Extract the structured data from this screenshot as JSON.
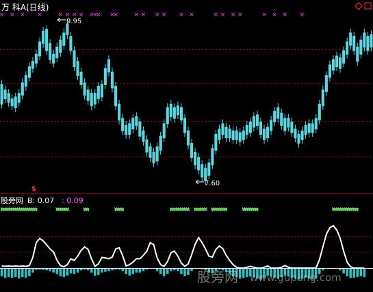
{
  "header": {
    "title": "万  科A(日线)",
    "icons": [
      "diamond-icon",
      "square-icon"
    ]
  },
  "sub_panel": {
    "label": "股旁网",
    "b_label": "B: 0.07",
    "c_label": ": 0.09",
    "warn_glyph": "$"
  },
  "watermark": {
    "text_cn": "股旁网",
    "text_url": "www.gupang.com"
  },
  "colors": {
    "background": "#000000",
    "up": "#ff3030",
    "down": "#5ad6e0",
    "grid": "#8a1010",
    "signal_marker": "#ff40ff",
    "strip": "#4cc14c",
    "line": "#ffffff",
    "hist": "#2ec0c0",
    "c_value": "#ff60ff"
  },
  "chart_data": {
    "type": "candlestick",
    "annotations": [
      {
        "text": "9.95",
        "kind": "high"
      },
      {
        "text": "7.60",
        "kind": "low"
      }
    ],
    "price_candles": [
      [
        10.35,
        9.8
      ],
      [
        10.2,
        9.95
      ],
      [
        10.1,
        9.85
      ],
      [
        9.95,
        9.75
      ],
      [
        10.0,
        9.7
      ],
      [
        10.1,
        9.85
      ],
      [
        10.4,
        10.05
      ],
      [
        10.6,
        10.3
      ],
      [
        10.85,
        10.55
      ],
      [
        11.0,
        10.8
      ],
      [
        11.2,
        10.95
      ],
      [
        11.55,
        11.15
      ],
      [
        11.85,
        11.5
      ],
      [
        11.9,
        11.3
      ],
      [
        11.5,
        11.05
      ],
      [
        11.2,
        10.95
      ],
      [
        11.4,
        11.1
      ],
      [
        11.6,
        11.25
      ],
      [
        11.8,
        11.45
      ],
      [
        12.05,
        11.75
      ],
      [
        11.7,
        11.3
      ],
      [
        11.3,
        10.85
      ],
      [
        11.0,
        10.6
      ],
      [
        10.7,
        10.35
      ],
      [
        10.4,
        10.05
      ],
      [
        10.2,
        9.9
      ],
      [
        10.1,
        9.75
      ],
      [
        10.1,
        9.8
      ],
      [
        10.3,
        9.95
      ],
      [
        10.35,
        10.0
      ],
      [
        10.8,
        10.35
      ],
      [
        11.05,
        10.7
      ],
      [
        10.7,
        10.25
      ],
      [
        10.3,
        9.75
      ],
      [
        9.8,
        9.35
      ],
      [
        9.4,
        9.05
      ],
      [
        9.2,
        8.95
      ],
      [
        9.25,
        8.95
      ],
      [
        9.4,
        9.1
      ],
      [
        9.45,
        9.2
      ],
      [
        9.3,
        8.9
      ],
      [
        9.05,
        8.75
      ],
      [
        8.8,
        8.45
      ],
      [
        8.6,
        8.3
      ],
      [
        8.45,
        8.15
      ],
      [
        8.6,
        8.2
      ],
      [
        8.9,
        8.5
      ],
      [
        9.25,
        8.85
      ],
      [
        9.7,
        9.25
      ],
      [
        9.8,
        9.45
      ],
      [
        9.7,
        9.4
      ],
      [
        9.75,
        9.5
      ],
      [
        9.7,
        9.35
      ],
      [
        9.4,
        9.0
      ],
      [
        9.05,
        8.65
      ],
      [
        8.7,
        8.3
      ],
      [
        8.45,
        8.1
      ],
      [
        8.3,
        7.95
      ],
      [
        8.1,
        7.75
      ],
      [
        8.0,
        7.65
      ],
      [
        8.15,
        7.8
      ],
      [
        8.55,
        8.1
      ],
      [
        8.95,
        8.5
      ],
      [
        9.1,
        8.8
      ],
      [
        9.25,
        8.95
      ],
      [
        9.15,
        8.85
      ],
      [
        9.1,
        8.85
      ],
      [
        9.05,
        8.8
      ],
      [
        9.05,
        8.8
      ],
      [
        9.0,
        8.75
      ],
      [
        9.05,
        8.8
      ],
      [
        9.2,
        8.95
      ],
      [
        9.3,
        9.0
      ],
      [
        9.45,
        9.15
      ],
      [
        9.5,
        9.2
      ],
      [
        9.3,
        8.95
      ],
      [
        9.1,
        8.8
      ],
      [
        9.15,
        8.85
      ],
      [
        9.35,
        9.05
      ],
      [
        9.6,
        9.3
      ],
      [
        9.7,
        9.4
      ],
      [
        9.55,
        9.2
      ],
      [
        9.4,
        9.05
      ],
      [
        9.4,
        9.15
      ],
      [
        9.3,
        9.0
      ],
      [
        9.1,
        8.85
      ],
      [
        8.95,
        8.7
      ],
      [
        9.05,
        8.8
      ],
      [
        9.2,
        8.95
      ],
      [
        9.25,
        9.0
      ],
      [
        9.25,
        9.0
      ],
      [
        9.4,
        9.1
      ],
      [
        9.8,
        9.35
      ],
      [
        10.2,
        9.75
      ],
      [
        10.6,
        10.15
      ],
      [
        10.9,
        10.55
      ],
      [
        11.05,
        10.75
      ],
      [
        11.15,
        10.85
      ],
      [
        11.1,
        10.8
      ],
      [
        11.3,
        10.95
      ],
      [
        11.55,
        11.2
      ],
      [
        11.8,
        11.45
      ],
      [
        11.7,
        11.3
      ],
      [
        11.4,
        11.0
      ],
      [
        11.6,
        11.2
      ],
      [
        11.8,
        11.4
      ],
      [
        11.7,
        11.3
      ],
      [
        11.75,
        11.4
      ]
    ],
    "signal_markers": [
      0,
      3,
      6,
      11,
      17,
      19,
      21,
      23,
      26,
      27,
      28,
      32,
      33,
      39,
      41,
      45,
      47,
      52,
      55,
      62,
      64,
      67,
      69,
      76,
      79,
      82,
      87
    ],
    "sub_strip_segments": [
      [
        0,
        11
      ],
      [
        16,
        20
      ],
      [
        24,
        26
      ],
      [
        33,
        36
      ],
      [
        49,
        55
      ],
      [
        56,
        60
      ],
      [
        61,
        66
      ],
      [
        70,
        75
      ],
      [
        96,
        104
      ]
    ],
    "sub_line": [
      0.05,
      0.04,
      0.05,
      0.04,
      0.05,
      0.04,
      0.05,
      0.04,
      0.06,
      0.25,
      0.6,
      0.7,
      0.64,
      0.55,
      0.45,
      0.38,
      0.18,
      0.06,
      0.03,
      0.08,
      0.22,
      0.18,
      0.28,
      0.42,
      0.5,
      0.44,
      0.22,
      0.04,
      0.1,
      0.25,
      0.24,
      0.22,
      0.26,
      0.45,
      0.48,
      0.3,
      0.05,
      0.08,
      0.14,
      0.22,
      0.22,
      0.3,
      0.4,
      0.6,
      0.55,
      0.24,
      0.08,
      0.04,
      0.15,
      0.36,
      0.4,
      0.28,
      0.12,
      0.04,
      0.1,
      0.32,
      0.56,
      0.72,
      0.6,
      0.45,
      0.28,
      0.26,
      0.44,
      0.52,
      0.46,
      0.3,
      0.18,
      0.08,
      0.02,
      0.0,
      0.0,
      0.02,
      0.04,
      0.02,
      0.0,
      0.0,
      0.02,
      0.05,
      0.0,
      0.0,
      0.0,
      0.02,
      0.06,
      0.02,
      0.0,
      0.0,
      0.0,
      0.0,
      0.0,
      0.0,
      0.0,
      0.0,
      0.2,
      0.5,
      0.8,
      0.95,
      1.0,
      0.9,
      0.7,
      0.4,
      0.14,
      0.03,
      0.0,
      0.0,
      0.0,
      0.0
    ],
    "sub_hist": [
      0.55,
      0.65,
      0.6,
      0.65,
      0.6,
      0.7,
      0.6,
      0.65,
      0.55,
      0.3,
      0.12,
      0.1,
      0.12,
      0.15,
      0.2,
      0.3,
      0.4,
      0.55,
      0.6,
      0.5,
      0.35,
      0.4,
      0.3,
      0.15,
      0.1,
      0.15,
      0.3,
      0.5,
      0.45,
      0.3,
      0.25,
      0.2,
      0.15,
      0.1,
      0.1,
      0.2,
      0.4,
      0.5,
      0.4,
      0.3,
      0.3,
      0.2,
      0.1,
      0.05,
      0.05,
      0.2,
      0.4,
      0.55,
      0.4,
      0.2,
      0.15,
      0.2,
      0.4,
      0.55,
      0.45,
      0.2,
      0.05,
      0.03,
      0.08,
      0.15,
      0.3,
      0.35,
      0.2,
      0.1,
      0.15,
      0.25,
      0.4,
      0.55,
      0.6,
      0.7,
      0.65,
      0.6,
      0.55,
      0.6,
      0.7,
      0.75,
      0.65,
      0.5,
      0.55,
      0.65,
      0.7,
      0.6,
      0.5,
      0.55,
      0.65,
      0.7,
      0.75,
      0.7,
      0.65,
      0.7,
      0.75,
      0.7,
      0.4,
      0.15,
      0.05,
      0.02,
      0.0,
      0.05,
      0.15,
      0.35,
      0.55,
      0.65,
      0.65,
      0.6,
      0.55,
      0.6
    ]
  }
}
